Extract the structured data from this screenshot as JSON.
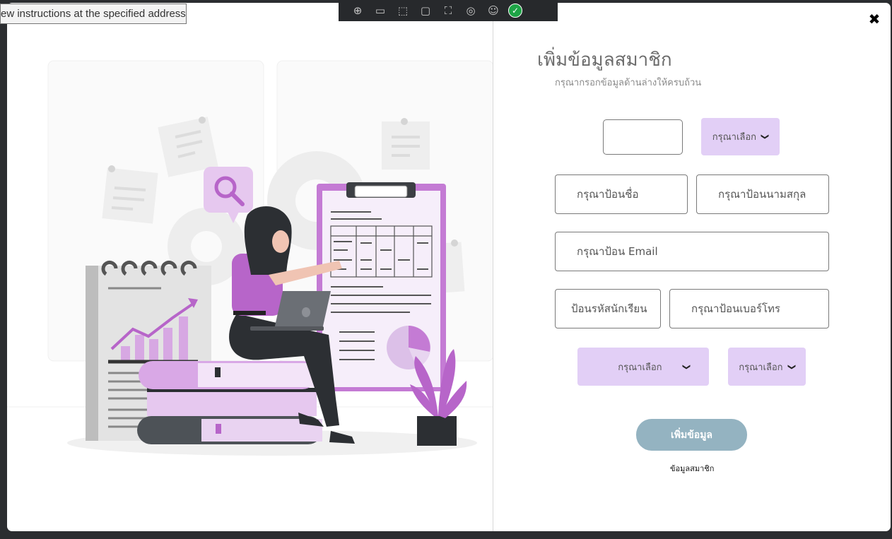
{
  "tooltip": {
    "text": "ew instructions at the specified address"
  },
  "devtools": {
    "icons": [
      "inspect-icon",
      "device-icon",
      "select-icon",
      "frame-icon",
      "screenshot-icon",
      "accessibility-icon",
      "person-icon",
      "check-icon"
    ]
  },
  "modal": {
    "close_label": "✖",
    "title": "เพิ่มข้อมูลสมาชิก",
    "subtitle": "กรุณากรอกข้อมูลด้านล่างให้ครบถ้วน",
    "prefix_select": "กรุณาเลือก",
    "firstname_placeholder": "กรุณาป้อนชื่อ",
    "lastname_placeholder": "กรุณาป้อนนามสกุล",
    "email_placeholder": "กรุณาป้อน Email",
    "studentid_placeholder": "ป้อนรหัสนักเรียน",
    "phone_placeholder": "กรุณาป้อนเบอร์โทร",
    "select_left": "กรุณาเลือก",
    "select_right": "กรุณาเลือก",
    "submit_label": "เพิ่มข้อมูล",
    "member_link": "ข้อมูลสมาชิก"
  },
  "colors": {
    "accent_purple": "#b765c9",
    "select_bg": "#e2cff6",
    "button_bg": "#94b3c1"
  }
}
